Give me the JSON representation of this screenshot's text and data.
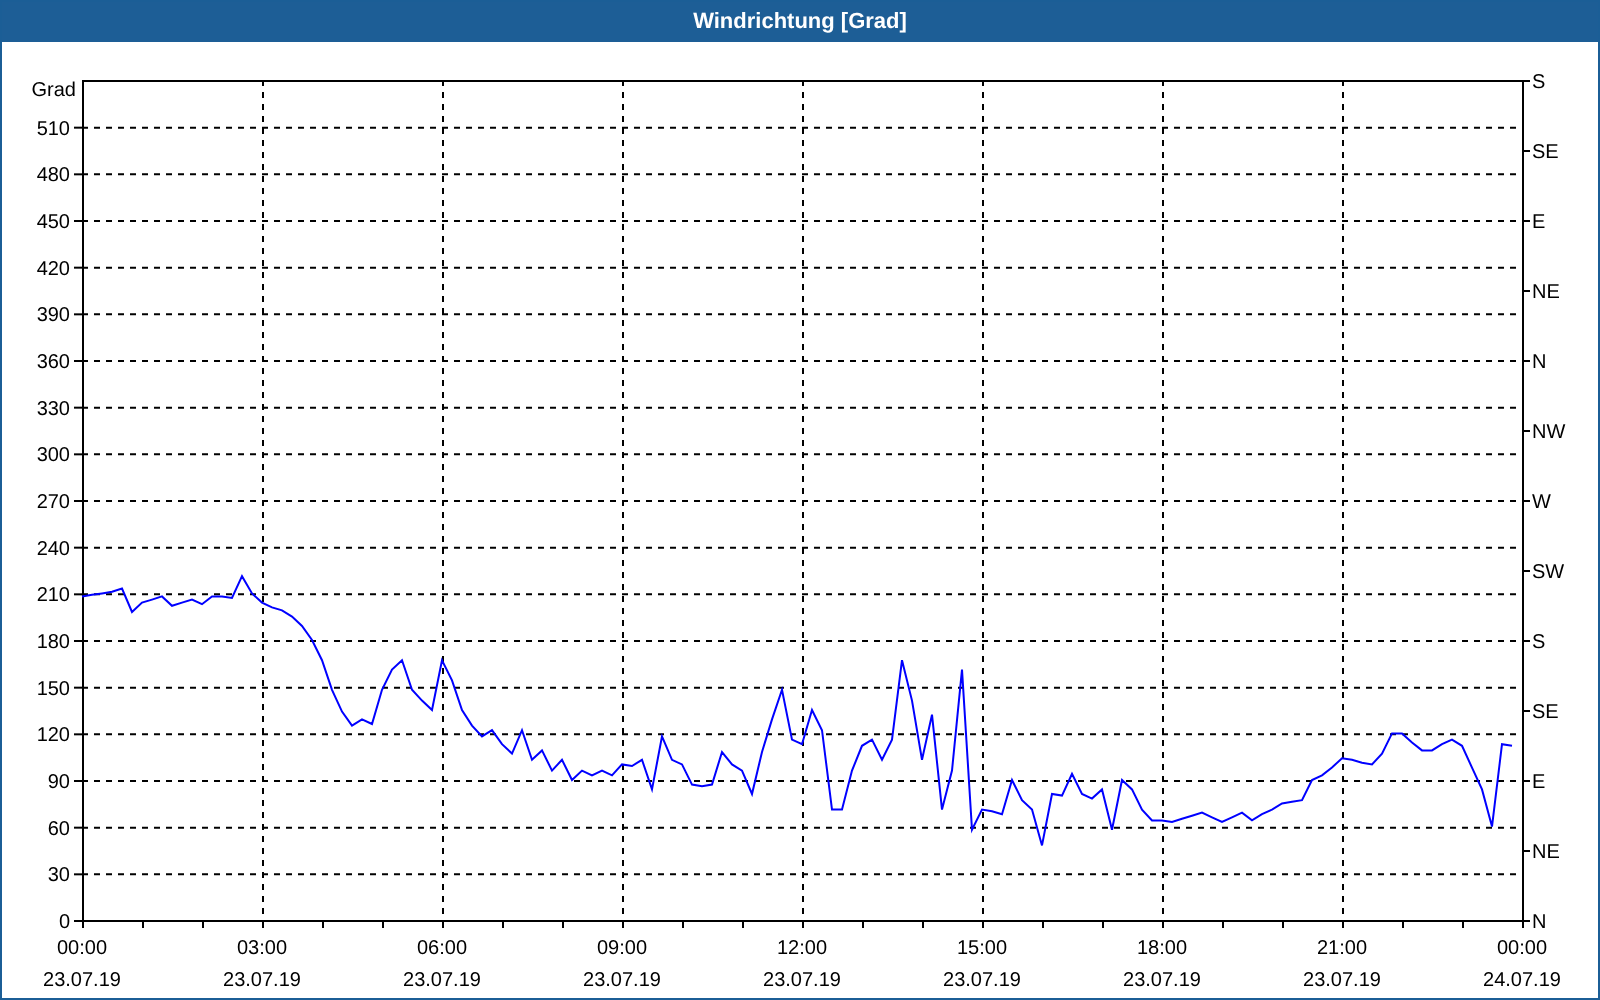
{
  "window": {
    "title": "Windrichtung [Grad]"
  },
  "compass_labels": [
    "S",
    "SE",
    "E",
    "NE",
    "N",
    "NW",
    "W",
    "SW",
    "S",
    "SE",
    "E",
    "NE",
    "N"
  ],
  "x_dates": [
    "23.07.19",
    "23.07.19",
    "23.07.19",
    "23.07.19",
    "23.07.19",
    "23.07.19",
    "23.07.19",
    "23.07.19",
    "24.07.19"
  ],
  "chart_data": {
    "type": "line",
    "grid": true,
    "ylabel": "Grad",
    "ylim": [
      0,
      540
    ],
    "yticks": [
      0,
      30,
      60,
      90,
      120,
      150,
      180,
      210,
      240,
      270,
      300,
      330,
      360,
      390,
      420,
      450,
      480,
      510
    ],
    "categories": [
      "00:00",
      null,
      null,
      null,
      null,
      null,
      null,
      null,
      null,
      null,
      null,
      null,
      null,
      null,
      null,
      null,
      null,
      null,
      "03:00",
      null,
      null,
      null,
      null,
      null,
      null,
      null,
      null,
      null,
      null,
      null,
      null,
      null,
      null,
      null,
      null,
      null,
      "06:00",
      null,
      null,
      null,
      null,
      null,
      null,
      null,
      null,
      null,
      null,
      null,
      null,
      null,
      null,
      null,
      null,
      null,
      "09:00",
      null,
      null,
      null,
      null,
      null,
      null,
      null,
      null,
      null,
      null,
      null,
      null,
      null,
      null,
      null,
      null,
      null,
      "12:00",
      null,
      null,
      null,
      null,
      null,
      null,
      null,
      null,
      null,
      null,
      null,
      null,
      null,
      null,
      null,
      null,
      null,
      "15:00",
      null,
      null,
      null,
      null,
      null,
      null,
      null,
      null,
      null,
      null,
      null,
      null,
      null,
      null,
      null,
      null,
      null,
      "18:00",
      null,
      null,
      null,
      null,
      null,
      null,
      null,
      null,
      null,
      null,
      null,
      null,
      null,
      null,
      null,
      null,
      null,
      "21:00",
      null,
      null,
      null,
      null,
      null,
      null,
      null,
      null,
      null,
      null,
      null,
      null,
      null,
      null,
      null,
      null,
      null,
      "00:00"
    ],
    "series": [
      {
        "color": "#0000ff",
        "values": [
          208,
          209,
          210,
          211,
          213,
          198,
          204,
          206,
          208,
          202,
          204,
          206,
          203,
          208,
          208,
          207,
          221,
          210,
          204,
          201,
          199,
          195,
          189,
          180,
          167,
          148,
          134,
          125,
          129,
          126,
          148,
          161,
          167,
          148,
          141,
          135,
          167,
          154,
          135,
          125,
          118,
          122,
          113,
          107,
          122,
          103,
          109,
          96,
          103,
          90,
          96,
          93,
          96,
          93,
          100,
          99,
          103,
          84,
          118,
          103,
          100,
          87,
          86,
          87,
          108,
          100,
          96,
          81,
          108,
          129,
          148,
          116,
          113,
          135,
          122,
          71,
          71,
          96,
          112,
          116,
          103,
          116,
          167,
          141,
          103,
          132,
          71,
          96,
          161,
          58,
          71,
          70,
          68,
          90,
          77,
          71,
          48,
          81,
          80,
          94,
          81,
          78,
          84,
          58,
          90,
          84,
          71,
          64,
          64,
          63,
          65,
          67,
          69,
          66,
          63,
          66,
          69,
          64,
          68,
          71,
          75,
          76,
          77,
          90,
          93,
          98,
          104,
          103,
          101,
          100,
          107,
          120,
          120,
          114,
          109,
          109,
          113,
          116,
          112,
          98,
          84,
          60,
          113,
          112,
          null
        ]
      }
    ]
  }
}
